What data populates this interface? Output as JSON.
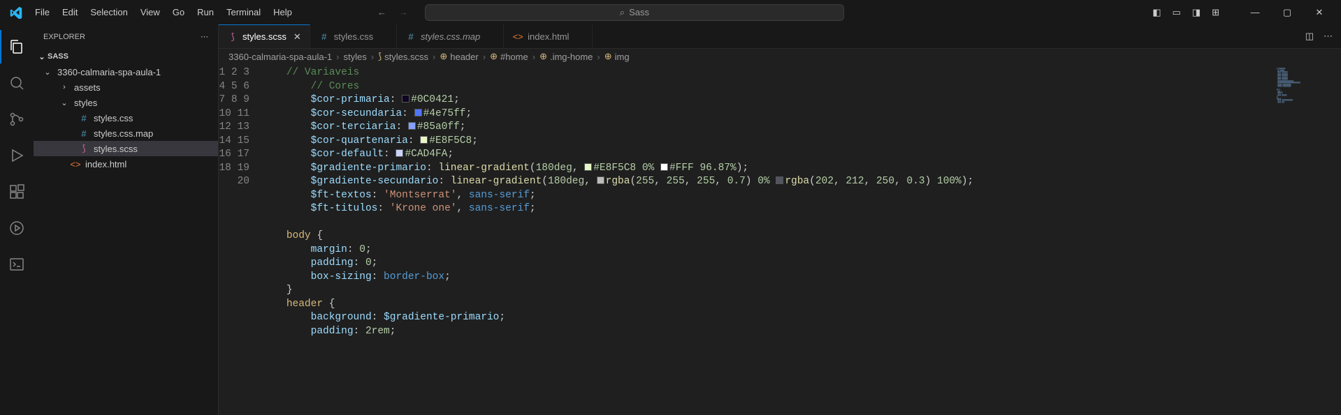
{
  "menu": [
    "File",
    "Edit",
    "Selection",
    "View",
    "Go",
    "Run",
    "Terminal",
    "Help"
  ],
  "search": {
    "placeholder": "Sass"
  },
  "explorer": {
    "title": "EXPLORER",
    "section": "SASS",
    "folder": "3360-calmaria-spa-aula-1",
    "items": [
      {
        "name": "assets",
        "type": "folder",
        "depth": 2,
        "expanded": false
      },
      {
        "name": "styles",
        "type": "folder",
        "depth": 2,
        "expanded": true
      },
      {
        "name": "styles.css",
        "type": "file",
        "icon": "css",
        "depth": 3
      },
      {
        "name": "styles.css.map",
        "type": "file",
        "icon": "css",
        "depth": 3
      },
      {
        "name": "styles.scss",
        "type": "file",
        "icon": "sass",
        "depth": 3,
        "selected": true
      },
      {
        "name": "index.html",
        "type": "file",
        "icon": "html",
        "depth": 2
      }
    ]
  },
  "tabs": [
    {
      "label": "styles.scss",
      "icon": "sass",
      "active": true
    },
    {
      "label": "styles.css",
      "icon": "css"
    },
    {
      "label": "styles.css.map",
      "icon": "css",
      "italic": true
    },
    {
      "label": "index.html",
      "icon": "html"
    }
  ],
  "breadcrumbs": [
    "3360-calmaria-spa-aula-1",
    "styles",
    "styles.scss",
    "header",
    "#home",
    ".img-home",
    "img"
  ],
  "code": {
    "cor_primaria": "#0C0421",
    "cor_secundaria": "#4e75ff",
    "cor_terciaria": "#85a0ff",
    "cor_quartenaria": "#E8F5C8",
    "cor_default": "#CAD4FA",
    "grad1_c1": "#E8F5C8",
    "grad1_p1": "0%",
    "grad1_c2": "#FFF",
    "grad1_p2": "96.87%",
    "grad2_c1": "rgba(255, 255, 255, 0.7)",
    "grad2_p1": "0%",
    "grad2_c2": "rgba(202, 212, 250, 0.3)",
    "grad2_p2": "100%",
    "ft_textos": "'Montserrat', sans-serif",
    "ft_titulos": "'Krone one', sans-serif",
    "padding_header": "2rem"
  },
  "line_count": 20
}
